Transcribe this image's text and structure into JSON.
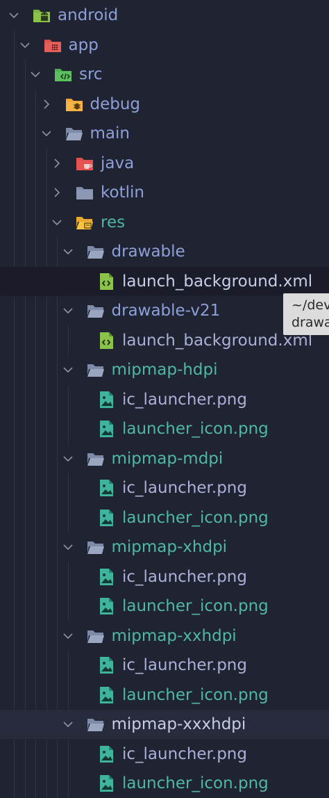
{
  "colors": {
    "background": "#1f2332",
    "folder_text": "#8ea0d8",
    "file_text": "#a9b1d6",
    "file_text_selected": "#c8cde6",
    "image_file_text": "#4fb8a5",
    "tooltip_bg": "#dcdcdc"
  },
  "tree": [
    {
      "label": "android",
      "kind": "folder",
      "expanded": true,
      "depth": 0,
      "icon": "android-folder-icon",
      "color": "#8ea0d8"
    },
    {
      "label": "app",
      "kind": "folder",
      "expanded": true,
      "depth": 1,
      "icon": "app-folder-icon",
      "color": "#8ea0d8"
    },
    {
      "label": "src",
      "kind": "folder",
      "expanded": true,
      "depth": 2,
      "icon": "src-folder-icon",
      "color": "#8ea0d8"
    },
    {
      "label": "debug",
      "kind": "folder",
      "expanded": false,
      "depth": 3,
      "icon": "debug-folder-icon",
      "color": "#8ea0d8"
    },
    {
      "label": "main",
      "kind": "folder",
      "expanded": true,
      "depth": 3,
      "icon": "folder-open-icon",
      "color": "#8ea0d8"
    },
    {
      "label": "java",
      "kind": "folder",
      "expanded": false,
      "depth": 4,
      "icon": "java-folder-icon",
      "color": "#8ea0d8"
    },
    {
      "label": "kotlin",
      "kind": "folder",
      "expanded": false,
      "depth": 4,
      "icon": "folder-icon",
      "color": "#8ea0d8"
    },
    {
      "label": "res",
      "kind": "folder",
      "expanded": true,
      "depth": 4,
      "icon": "res-folder-icon",
      "color": "#4fb8a5"
    },
    {
      "label": "drawable",
      "kind": "folder",
      "expanded": true,
      "depth": 5,
      "icon": "folder-open-icon",
      "color": "#8ea0d8"
    },
    {
      "label": "launch_background.xml",
      "kind": "file",
      "depth": 6,
      "icon": "xml-file-icon",
      "color": "#c8cde6",
      "highlight": "hl"
    },
    {
      "label": "drawable-v21",
      "kind": "folder",
      "expanded": true,
      "depth": 5,
      "icon": "folder-open-icon",
      "color": "#8ea0d8"
    },
    {
      "label": "launch_background.xml",
      "kind": "file",
      "depth": 6,
      "icon": "xml-file-icon",
      "color": "#a9b1d6"
    },
    {
      "label": "mipmap-hdpi",
      "kind": "folder",
      "expanded": true,
      "depth": 5,
      "icon": "folder-open-icon",
      "color": "#4fb8a5"
    },
    {
      "label": "ic_launcher.png",
      "kind": "file",
      "depth": 6,
      "icon": "image-file-icon",
      "color": "#a9b1d6"
    },
    {
      "label": "launcher_icon.png",
      "kind": "file",
      "depth": 6,
      "icon": "image-file-icon",
      "color": "#4fb8a5"
    },
    {
      "label": "mipmap-mdpi",
      "kind": "folder",
      "expanded": true,
      "depth": 5,
      "icon": "folder-open-icon",
      "color": "#4fb8a5"
    },
    {
      "label": "ic_launcher.png",
      "kind": "file",
      "depth": 6,
      "icon": "image-file-icon",
      "color": "#a9b1d6"
    },
    {
      "label": "launcher_icon.png",
      "kind": "file",
      "depth": 6,
      "icon": "image-file-icon",
      "color": "#4fb8a5"
    },
    {
      "label": "mipmap-xhdpi",
      "kind": "folder",
      "expanded": true,
      "depth": 5,
      "icon": "folder-open-icon",
      "color": "#4fb8a5"
    },
    {
      "label": "ic_launcher.png",
      "kind": "file",
      "depth": 6,
      "icon": "image-file-icon",
      "color": "#a9b1d6"
    },
    {
      "label": "launcher_icon.png",
      "kind": "file",
      "depth": 6,
      "icon": "image-file-icon",
      "color": "#4fb8a5"
    },
    {
      "label": "mipmap-xxhdpi",
      "kind": "folder",
      "expanded": true,
      "depth": 5,
      "icon": "folder-open-icon",
      "color": "#4fb8a5"
    },
    {
      "label": "ic_launcher.png",
      "kind": "file",
      "depth": 6,
      "icon": "image-file-icon",
      "color": "#a9b1d6"
    },
    {
      "label": "launcher_icon.png",
      "kind": "file",
      "depth": 6,
      "icon": "image-file-icon",
      "color": "#4fb8a5"
    },
    {
      "label": "mipmap-xxxhdpi",
      "kind": "folder",
      "expanded": true,
      "depth": 5,
      "icon": "folder-open-icon",
      "color": "#c8cde6",
      "highlight": "hl2"
    },
    {
      "label": "ic_launcher.png",
      "kind": "file",
      "depth": 6,
      "icon": "image-file-icon",
      "color": "#a9b1d6"
    },
    {
      "label": "launcher_icon.png",
      "kind": "file",
      "depth": 6,
      "icon": "image-file-icon",
      "color": "#4fb8a5"
    }
  ],
  "tooltip": {
    "line1": "~/dev",
    "line2": "drawa"
  }
}
